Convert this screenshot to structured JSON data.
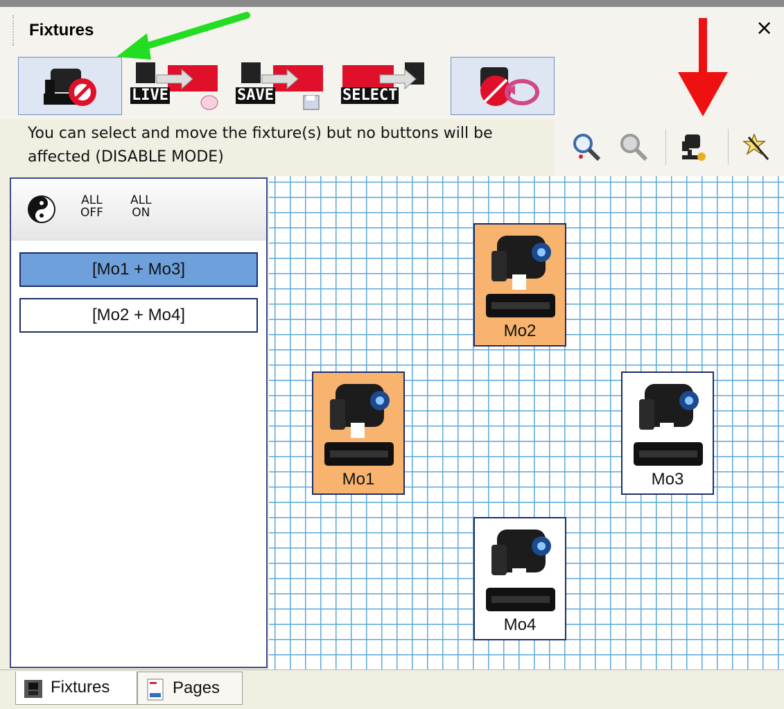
{
  "window": {
    "title": "Fixtures",
    "close_symbol": "×"
  },
  "toolbar": {
    "buttons": [
      {
        "name": "disable-mode",
        "icon": "fixture-disable-icon",
        "active": true
      },
      {
        "name": "live-mode",
        "icon": "fixture-live-icon",
        "label": "LIVE"
      },
      {
        "name": "save-mode",
        "icon": "fixture-save-icon",
        "label": "SAVE"
      },
      {
        "name": "select-mode",
        "icon": "fixture-select-icon",
        "label": "SELECT"
      },
      {
        "name": "unlink",
        "icon": "fixture-unlink-icon",
        "active": true
      }
    ]
  },
  "hint": "You can select and move the fixture(s) but no buttons will be affected (DISABLE MODE)",
  "zoom_tools": [
    {
      "name": "zoom-in",
      "icon": "zoom-in-icon"
    },
    {
      "name": "zoom-out",
      "icon": "zoom-out-icon",
      "disabled": true
    },
    {
      "name": "fixture-settings",
      "icon": "fixture-settings-icon"
    },
    {
      "name": "clear",
      "icon": "wand-icon"
    }
  ],
  "left_panel": {
    "all_off": "ALL\nOFF",
    "all_on": "ALL\nON",
    "all_off_line1": "ALL",
    "all_off_line2": "OFF",
    "all_on_line1": "ALL",
    "all_on_line2": "ON",
    "groups": [
      {
        "label": "[Mo1 + Mo3]",
        "selected": true
      },
      {
        "label": "[Mo2 + Mo4]",
        "selected": false
      }
    ]
  },
  "fixtures": [
    {
      "label": "Mo2",
      "state": "on"
    },
    {
      "label": "Mo1",
      "state": "on"
    },
    {
      "label": "Mo3",
      "state": "off"
    },
    {
      "label": "Mo4",
      "state": "off"
    }
  ],
  "tabs": [
    {
      "label": "Fixtures",
      "active": true
    },
    {
      "label": "Pages",
      "active": false
    }
  ],
  "colors": {
    "selected_group": "#6ea0dc",
    "fixture_on": "#f8b36e",
    "grid_line": "#5aa7d9",
    "arrow_green": "#22dd22",
    "arrow_red": "#ee1111"
  }
}
